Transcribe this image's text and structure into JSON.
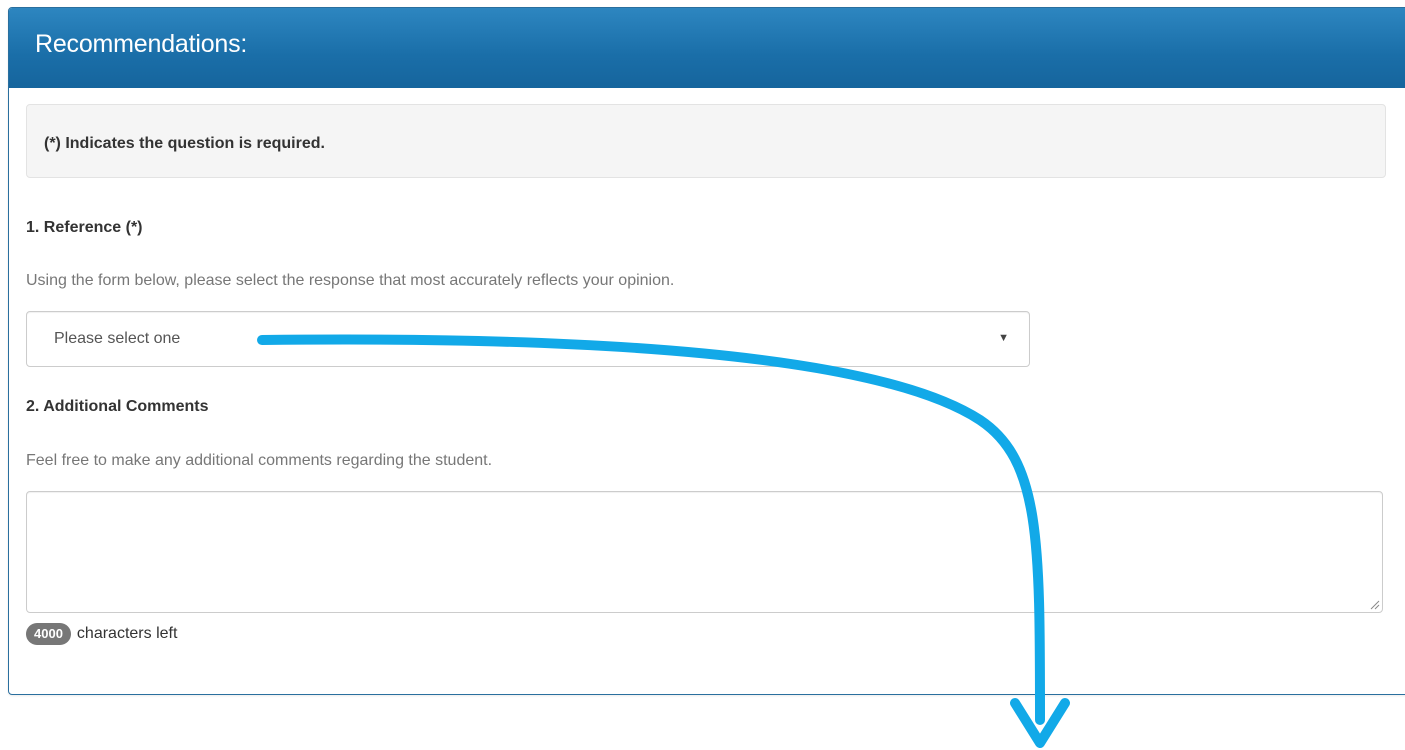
{
  "panel": {
    "title": "Recommendations:"
  },
  "notice": {
    "text": "(*) Indicates the question is required."
  },
  "questions": [
    {
      "label": "1. Reference  (*)",
      "help": "Using the form below, please select the response that most accurately reflects your opinion.",
      "select": {
        "value": "Please select one",
        "caret_icon": "caret-down-icon"
      }
    },
    {
      "label": "2. Additional Comments",
      "help": "Feel free to make any additional comments regarding the student.",
      "textarea": {
        "value": ""
      },
      "counter": {
        "count": "4000",
        "suffix": "characters left"
      }
    }
  ],
  "colors": {
    "header_top": "#2d86c0",
    "header_bottom": "#16659d",
    "annotation_arrow": "#12a9e8"
  }
}
